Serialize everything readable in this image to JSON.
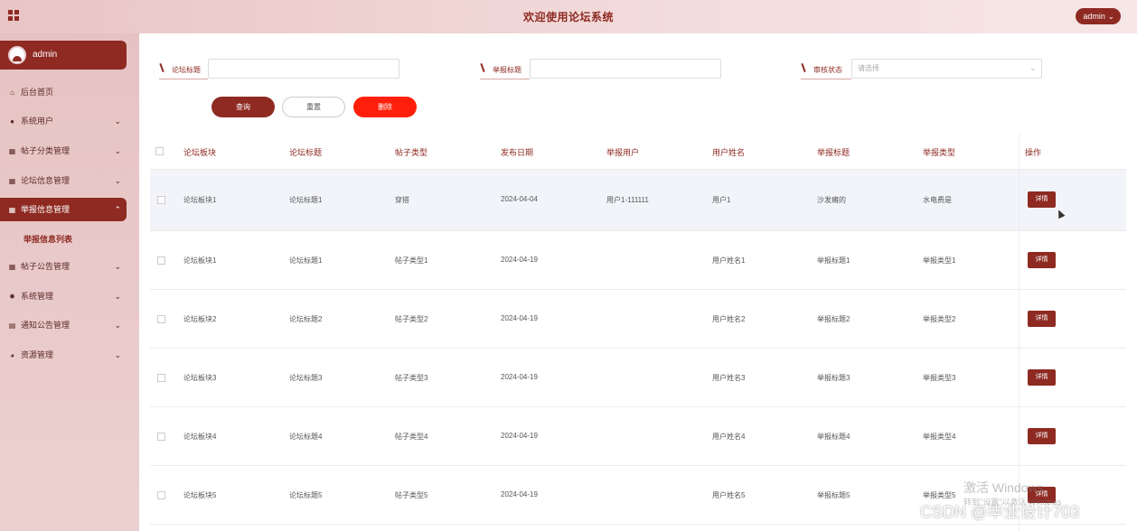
{
  "header": {
    "title": "欢迎使用论坛系统",
    "user_label": "admin"
  },
  "sidebar": {
    "user_name": "admin",
    "items": [
      {
        "label": "后台首页",
        "icon": "home-icon",
        "has_children": false
      },
      {
        "label": "系统用户",
        "icon": "user-icon",
        "has_children": true
      },
      {
        "label": "帖子分类管理",
        "icon": "grid-icon",
        "has_children": true
      },
      {
        "label": "论坛信息管理",
        "icon": "grid-icon",
        "has_children": true
      },
      {
        "label": "举报信息管理",
        "icon": "grid-icon",
        "has_children": true,
        "active": true
      },
      {
        "label": "帖子公告管理",
        "icon": "grid-icon",
        "has_children": true
      },
      {
        "label": "系统管理",
        "icon": "gear-icon",
        "has_children": true
      },
      {
        "label": "通知公告管理",
        "icon": "document-icon",
        "has_children": true
      },
      {
        "label": "资源管理",
        "icon": "pie-chart-icon",
        "has_children": true
      }
    ],
    "submenu_active": "举报信息列表"
  },
  "search": {
    "forum_title_label": "论坛标题",
    "forum_title_value": "",
    "report_title_label": "举报标题",
    "report_title_value": "",
    "status_label": "审核状态",
    "status_placeholder": "请选择"
  },
  "buttons": {
    "query": "查询",
    "reset": "重置",
    "delete": "删除",
    "detail": "详情"
  },
  "table": {
    "headers": [
      "论坛板块",
      "论坛标题",
      "帖子类型",
      "发布日期",
      "举报用户",
      "用户姓名",
      "举报标题",
      "举报类型",
      "操作"
    ],
    "rows": [
      [
        "论坛板块1",
        "论坛标题1",
        "穿搭",
        "2024-04-04",
        "用户1-111111",
        "用户1",
        "沙发瘫的",
        "水电费是"
      ],
      [
        "论坛板块1",
        "论坛标题1",
        "帖子类型1",
        "2024-04-19",
        "",
        "用户姓名1",
        "举报标题1",
        "举报类型1"
      ],
      [
        "论坛板块2",
        "论坛标题2",
        "帖子类型2",
        "2024-04-19",
        "",
        "用户姓名2",
        "举报标题2",
        "举报类型2"
      ],
      [
        "论坛板块3",
        "论坛标题3",
        "帖子类型3",
        "2024-04-19",
        "",
        "用户姓名3",
        "举报标题3",
        "举报类型3"
      ],
      [
        "论坛板块4",
        "论坛标题4",
        "帖子类型4",
        "2024-04-19",
        "",
        "用户姓名4",
        "举报标题4",
        "举报类型4"
      ],
      [
        "论坛板块5",
        "论坛标题5",
        "帖子类型5",
        "2024-04-19",
        "",
        "用户姓名5",
        "举报标题5",
        "举报类型5"
      ]
    ]
  },
  "watermark": {
    "activate_title": "激活 Windows",
    "activate_sub": "转到\"设置\"以激活 Windows",
    "csdn": "CSDN @毕业设计703"
  },
  "colors": {
    "primary": "#8e2a22",
    "danger": "#ff1f0a",
    "sidebar_bg": "#e9c7c7"
  }
}
